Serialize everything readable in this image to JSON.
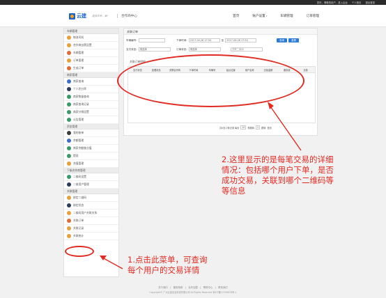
{
  "topbar": {
    "links": [
      "您好，尊敬的用户，进入后台",
      "个人首页",
      "退出登录"
    ]
  },
  "header": {
    "logo_text": "云建",
    "slogan": "连接未来，赢！",
    "sub_title": "合作商中心",
    "nav": [
      {
        "label": "首页",
        "caret": false
      },
      {
        "label": "账户设置",
        "caret": true
      },
      {
        "label": "车辆管理",
        "caret": false
      },
      {
        "label": "订单管理",
        "caret": false
      }
    ]
  },
  "sidebar": {
    "groups": [
      {
        "title": "车辆管理",
        "items": [
          {
            "label": "物流司机",
            "color": "#e8a13a"
          },
          {
            "label": "合作商自营设置",
            "color": "#e8a13a"
          },
          {
            "label": "车辆管理",
            "color": "#e06a3a"
          },
          {
            "label": "订单管理",
            "color": "#e8a13a"
          },
          {
            "label": "生成订单",
            "color": "#e06a3a"
          }
        ]
      },
      {
        "title": "商家管理",
        "items": [
          {
            "label": "商家查询",
            "color": "#3a6ec8"
          },
          {
            "label": "个人积分率",
            "color": "#2d3b5a"
          },
          {
            "label": "商家数量查询",
            "color": "#3a9a6a"
          },
          {
            "label": "商家查询记录",
            "color": "#3a9a6a"
          },
          {
            "label": "商家分销设置",
            "color": "#3a9a6a"
          },
          {
            "label": "公告管理",
            "color": "#3a9a6a"
          }
        ]
      },
      {
        "title": "资金管理",
        "items": [
          {
            "label": "我的账单",
            "color": "#3b3b3b"
          },
          {
            "label": "余额管理",
            "color": "#3a6ec8"
          },
          {
            "label": "商家余额查点值",
            "color": "#3a9a6a"
          },
          {
            "label": "提现",
            "color": "#3a9a6a"
          },
          {
            "label": "充值管理",
            "color": "#e8a13a"
          }
        ]
      },
      {
        "title": "下级合作商管理",
        "items": [
          {
            "label": "二维码设置",
            "color": "#3a9a6a"
          },
          {
            "label": "二维用户管理",
            "color": "#2d3b5a"
          }
        ]
      },
      {
        "title": "关联管理",
        "items": [
          {
            "label": "绑定二维码",
            "color": "#e8a13a"
          },
          {
            "label": "绑定状态",
            "color": "#2d3b5a"
          },
          {
            "label": "二维码用户关联关系",
            "color": "#e8a13a"
          },
          {
            "label": "关联订单",
            "color": "#e06a3a"
          },
          {
            "label": "关联记录",
            "color": "#e8a13a"
          },
          {
            "label": "关联统计",
            "color": "#e8a13a"
          }
        ]
      }
    ]
  },
  "main": {
    "title": "关联订单",
    "form": {
      "car_label": "车辆编号:",
      "order_time_label": "下单时间:",
      "date_from": "2017-04-26 17:54",
      "date_sep": "至",
      "date_to": "2017-06-26 17:54",
      "query_button": "查询",
      "reset_button": "重置",
      "pay_status_label": "支付状态:",
      "pay_status_value": "请选择",
      "order_status_label": "订单状态:",
      "order_status_value": "请选择",
      "qrcode_placeholder": "关联二维码"
    },
    "sub_title": "关联订单明细",
    "columns": [
      "支付状态",
      "处理状态",
      "关联合作商",
      "下单时间",
      "车辆号",
      "起点位置",
      "用户名称",
      "交易金额",
      "服务费",
      "交易"
    ],
    "pager": {
      "summary": "共0页,0条记录 每页",
      "page_size": "10",
      "page_jump": "条跳转",
      "page_no": "1",
      "go": "跳转",
      "first": "首页"
    }
  },
  "annotations": {
    "note_detail": [
      "2.这里显示的是每笔交易的详细",
      "情况：包括哪个用户下单，是否",
      "成功交易，关联到哪个二维码等",
      "等信息"
    ],
    "note_menu": [
      "1.点击此菜单，可查询",
      "每个用户的交易详情"
    ],
    "color": "#e12a22"
  },
  "footer": {
    "links": "关于我们　|　服务条款　|　合作加盟　|　帮助中心　|　联系我们",
    "copyright": "Copyright© 广州云建信息科技有限公司 All Rights Reserved  粤ICP备12345678号-1"
  }
}
